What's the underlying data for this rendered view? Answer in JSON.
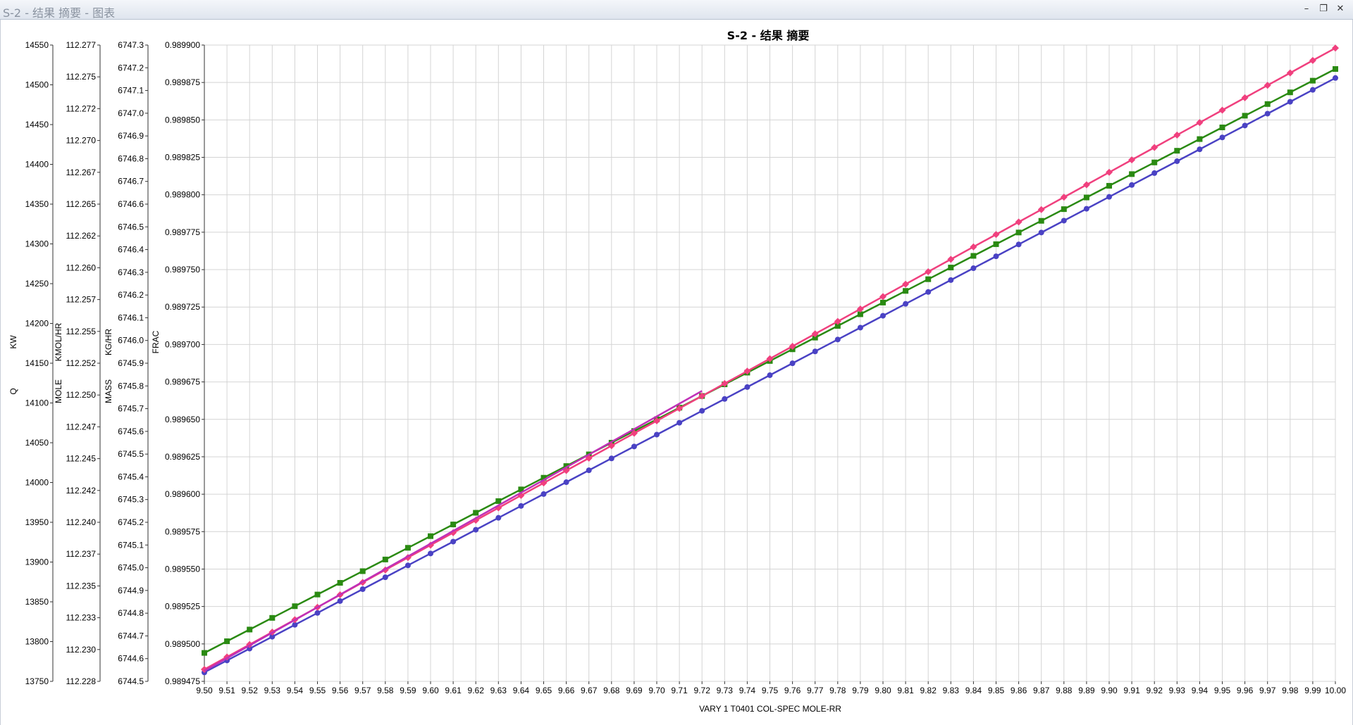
{
  "window": {
    "title": "S-2 - 结果 摘要 - 图表",
    "buttons": {
      "minimize": "–",
      "restore": "❐",
      "close": "✕"
    }
  },
  "chart_data": {
    "type": "line",
    "title": "S-2 - 结果 摘要",
    "xlabel": "VARY   1 T0401     COL-SPEC MOLE-RR",
    "x_ticks": [
      "9.50",
      "9.51",
      "9.52",
      "9.53",
      "9.54",
      "9.55",
      "9.56",
      "9.57",
      "9.58",
      "9.59",
      "9.60",
      "9.61",
      "9.62",
      "9.63",
      "9.64",
      "9.65",
      "9.66",
      "9.67",
      "9.68",
      "9.69",
      "9.70",
      "9.71",
      "9.72",
      "9.73",
      "9.74",
      "9.75",
      "9.76",
      "9.77",
      "9.78",
      "9.79",
      "9.80",
      "9.81",
      "9.82",
      "9.83",
      "9.84",
      "9.85",
      "9.86",
      "9.87",
      "9.88",
      "9.89",
      "9.90",
      "9.91",
      "9.92",
      "9.93",
      "9.94",
      "9.95",
      "9.96",
      "9.97",
      "9.98",
      "9.99",
      "10.00"
    ],
    "xlim": [
      9.5,
      10.0
    ],
    "grid": true,
    "y_axes": [
      {
        "id": "q",
        "label_top": "KW",
        "label_bottom": "Q",
        "ylim": [
          13750,
          14550
        ],
        "ticks": [
          "13750",
          "13800",
          "13850",
          "13900",
          "13950",
          "14000",
          "14050",
          "14100",
          "14150",
          "14200",
          "14250",
          "14300",
          "14350",
          "14400",
          "14450",
          "14500",
          "14550"
        ]
      },
      {
        "id": "mole",
        "label_top": "KMOL/HR",
        "label_bottom": "MOLE",
        "ylim": [
          112.228,
          112.277
        ],
        "ticks": [
          "112.228",
          "112.230",
          "112.233",
          "112.235",
          "112.237",
          "112.240",
          "112.242",
          "112.245",
          "112.247",
          "112.250",
          "112.252",
          "112.255",
          "112.257",
          "112.260",
          "112.262",
          "112.265",
          "112.267",
          "112.270",
          "112.272",
          "112.275",
          "112.277"
        ]
      },
      {
        "id": "mass",
        "label_top": "KG/HR",
        "label_bottom": "MASS",
        "ylim": [
          6744.5,
          6747.3
        ],
        "ticks": [
          "6744.5",
          "6744.6",
          "6744.7",
          "6744.8",
          "6744.9",
          "6745.0",
          "6745.1",
          "6745.2",
          "6745.3",
          "6745.4",
          "6745.5",
          "6745.6",
          "6745.7",
          "6745.8",
          "6745.9",
          "6746.0",
          "6746.1",
          "6746.2",
          "6746.3",
          "6746.4",
          "6746.5",
          "6746.6",
          "6746.7",
          "6746.8",
          "6746.9",
          "6747.0",
          "6747.1",
          "6747.2",
          "6747.3"
        ]
      },
      {
        "id": "frac",
        "label_top": "FRAC",
        "label_bottom": "",
        "ylim": [
          0.989475,
          0.9899
        ],
        "ticks": [
          "0.989475",
          "0.989500",
          "0.989525",
          "0.989550",
          "0.989575",
          "0.989600",
          "0.989625",
          "0.989650",
          "0.989675",
          "0.989700",
          "0.989725",
          "0.989750",
          "0.989775",
          "0.989800",
          "0.989825",
          "0.989850",
          "0.989875",
          "0.989900"
        ]
      }
    ],
    "series": [
      {
        "color": "#2a8a12",
        "marker": "square",
        "x_start": 9.5,
        "x_end": 10.0,
        "x_step": 0.01,
        "axis": "frac",
        "y_start": 0.989494,
        "y_end": 0.989884
      },
      {
        "color": "#4a42c4",
        "marker": "circle",
        "x_start": 9.5,
        "x_end": 10.0,
        "x_step": 0.01,
        "axis": "frac",
        "y_start": 0.989481,
        "y_end": 0.989878
      },
      {
        "color": "#f0407e",
        "marker": "diamond",
        "x_start": 9.5,
        "x_end": 10.0,
        "x_step": 0.01,
        "axis": "frac",
        "y_start": 0.989483,
        "y_end": 0.989898
      },
      {
        "color": "#c030b8",
        "marker": "none",
        "x_start": 9.5,
        "x_end": 9.72,
        "x_step": 0.22,
        "axis": "frac",
        "y_start": 0.989482,
        "y_end": 0.989669
      }
    ]
  }
}
